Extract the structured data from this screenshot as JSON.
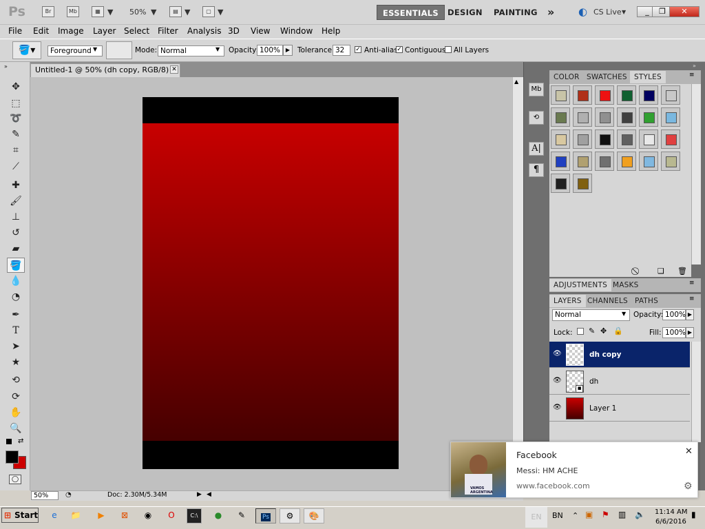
{
  "app": {
    "logo": "Ps",
    "bridge": "Br",
    "mini_bridge": "Mb",
    "zoom": "50%",
    "workspaces": [
      "ESSENTIALS",
      "DESIGN",
      "PAINTING"
    ],
    "more": "»",
    "cslive": "CS Live"
  },
  "menu": [
    "File",
    "Edit",
    "Image",
    "Layer",
    "Select",
    "Filter",
    "Analysis",
    "3D",
    "View",
    "Window",
    "Help"
  ],
  "options": {
    "fill_source": "Foreground",
    "mode_label": "Mode:",
    "mode": "Normal",
    "opacity_label": "Opacity:",
    "opacity": "100%",
    "tolerance_label": "Tolerance:",
    "tolerance": "32",
    "antialias": "Anti-alias",
    "contiguous": "Contiguous",
    "all_layers": "All Layers"
  },
  "document": {
    "tab": "Untitled-1 @ 50% (dh copy, RGB/8) *",
    "zoom": "50%",
    "doc_size": "Doc: 2.30M/5.34M",
    "band_color": "#000000",
    "gradient_top": "#c80000",
    "gradient_bottom": "#460000"
  },
  "panels": {
    "top_tabs": [
      "COLOR",
      "SWATCHES",
      "STYLES"
    ],
    "adj_tabs": [
      "ADJUSTMENTS",
      "MASKS"
    ],
    "layer_tabs": [
      "LAYERS",
      "CHANNELS",
      "PATHS"
    ],
    "blend": "Normal",
    "opacity_label": "Opacity:",
    "opacity": "100%",
    "lock_label": "Lock:",
    "fill_label": "Fill:",
    "fill": "100%",
    "layers": [
      {
        "name": "dh copy"
      },
      {
        "name": "dh"
      },
      {
        "name": "Layer 1"
      }
    ],
    "styles": [
      "#c8c4a8",
      "#b03018",
      "#ee1111",
      "#106030",
      "#000060",
      "#c8c8c8",
      "#6a7a50",
      "#b0b0b0",
      "#909090",
      "#404040",
      "#30a030",
      "#7ab8e0",
      "#d8c8a0",
      "#a0a0a0",
      "#101010",
      "#606060",
      "#e8e8e8",
      "#e04040",
      "#2040c0",
      "#b0a070",
      "#707070",
      "#f0a020",
      "#80b8e0",
      "#b8b890",
      "#202020",
      "#806010"
    ]
  },
  "toast": {
    "title": "Facebook",
    "message": "Messi: HM ACHE",
    "source": "www.facebook.com",
    "photo_caption": "VAMOS ARGENTINA"
  },
  "taskbar": {
    "start": "Start",
    "lang": "EN",
    "lang2": "BN",
    "time": "11:14 AM",
    "date": "6/6/2016"
  }
}
